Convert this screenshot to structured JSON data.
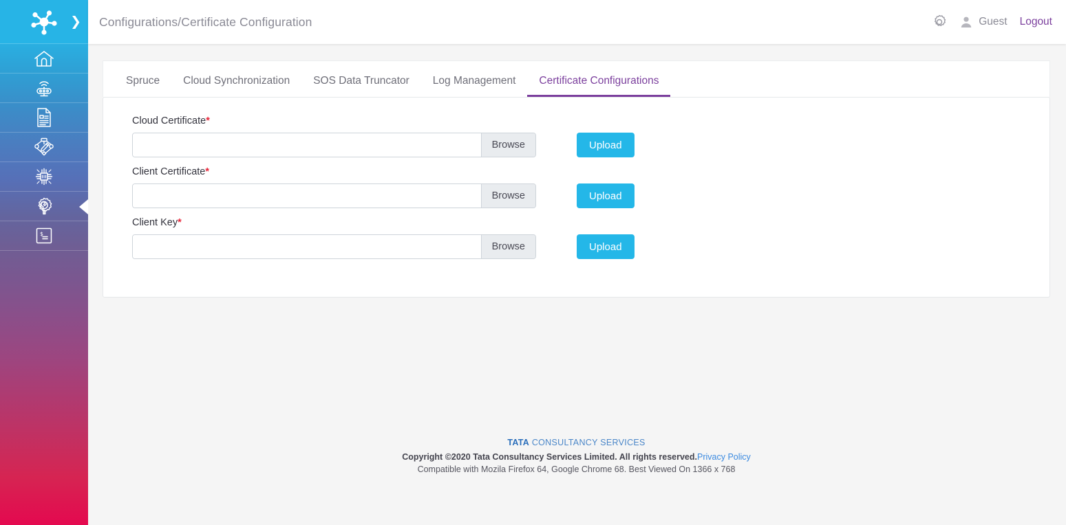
{
  "sidebar": {
    "logo": {
      "icon": "network-hub-logo",
      "expand_icon": "chevron-right-icon"
    },
    "collapse_toggle": {
      "icon": "collapse-left-triangle-icon"
    },
    "items": [
      {
        "icon": "home-icon",
        "name": "home"
      },
      {
        "icon": "gateway-wifi-icon",
        "name": "gateway"
      },
      {
        "icon": "document-icon",
        "name": "documents"
      },
      {
        "icon": "circuit-pencil-icon",
        "name": "designer"
      },
      {
        "icon": "microchip-icon",
        "name": "devices"
      },
      {
        "icon": "gear-wrench-icon",
        "name": "configurations"
      },
      {
        "icon": "terminal-console-icon",
        "name": "console"
      }
    ]
  },
  "topbar": {
    "breadcrumb": "Configurations/Certificate Configuration",
    "settings_icon": "gear-icon",
    "avatar_icon": "user-avatar-icon",
    "user_name": "Guest",
    "logout_label": "Logout"
  },
  "tabs": [
    {
      "label": "Spruce",
      "active": false
    },
    {
      "label": "Cloud Synchronization",
      "active": false
    },
    {
      "label": "SOS Data Truncator",
      "active": false
    },
    {
      "label": "Log Management",
      "active": false
    },
    {
      "label": "Certificate Configurations",
      "active": true
    }
  ],
  "form": {
    "fields": [
      {
        "label": "Cloud Certificate",
        "required_marker": "*",
        "value": "",
        "placeholder": "",
        "browse_label": "Browse",
        "upload_label": "Upload"
      },
      {
        "label": "Client Certificate",
        "required_marker": "*",
        "value": "",
        "placeholder": "",
        "browse_label": "Browse",
        "upload_label": "Upload"
      },
      {
        "label": "Client Key",
        "required_marker": "*",
        "value": "",
        "placeholder": "",
        "browse_label": "Browse",
        "upload_label": "Upload"
      }
    ]
  },
  "footer": {
    "brand_bold": "TATA",
    "brand_rest": " CONSULTANCY SERVICES",
    "copyright": "Copyright ©2020 Tata Consultancy Services Limited. All rights reserved.",
    "privacy_label": "Privacy Policy",
    "compatibility": "Compatible with Mozila Firefox 64, Google Chrome 68. Best Viewed On 1366 x 768"
  },
  "colors": {
    "accent_cyan": "#24b7e8",
    "accent_purple": "#7b3f9d",
    "required_red": "#e8263a",
    "link_blue": "#3b8ae0",
    "page_bg": "#f5f5f5"
  }
}
